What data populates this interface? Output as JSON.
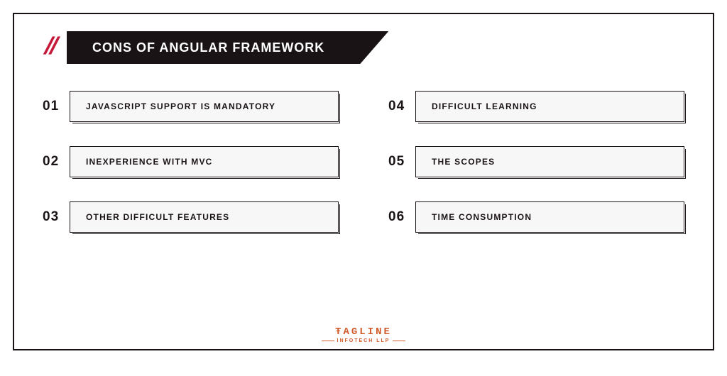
{
  "title": "CONS OF ANGULAR FRAMEWORK",
  "items": [
    {
      "num": "01",
      "label": "JAVASCRIPT SUPPORT IS MANDATORY"
    },
    {
      "num": "02",
      "label": "INEXPERIENCE WITH MVC"
    },
    {
      "num": "03",
      "label": "OTHER DIFFICULT FEATURES"
    },
    {
      "num": "04",
      "label": "DIFFICULT LEARNING"
    },
    {
      "num": "05",
      "label": "THE SCOPES"
    },
    {
      "num": "06",
      "label": "TIME CONSUMPTION"
    }
  ],
  "brand": {
    "top": "ŦAGLINE",
    "bottom": "INFOTECH LLP"
  }
}
